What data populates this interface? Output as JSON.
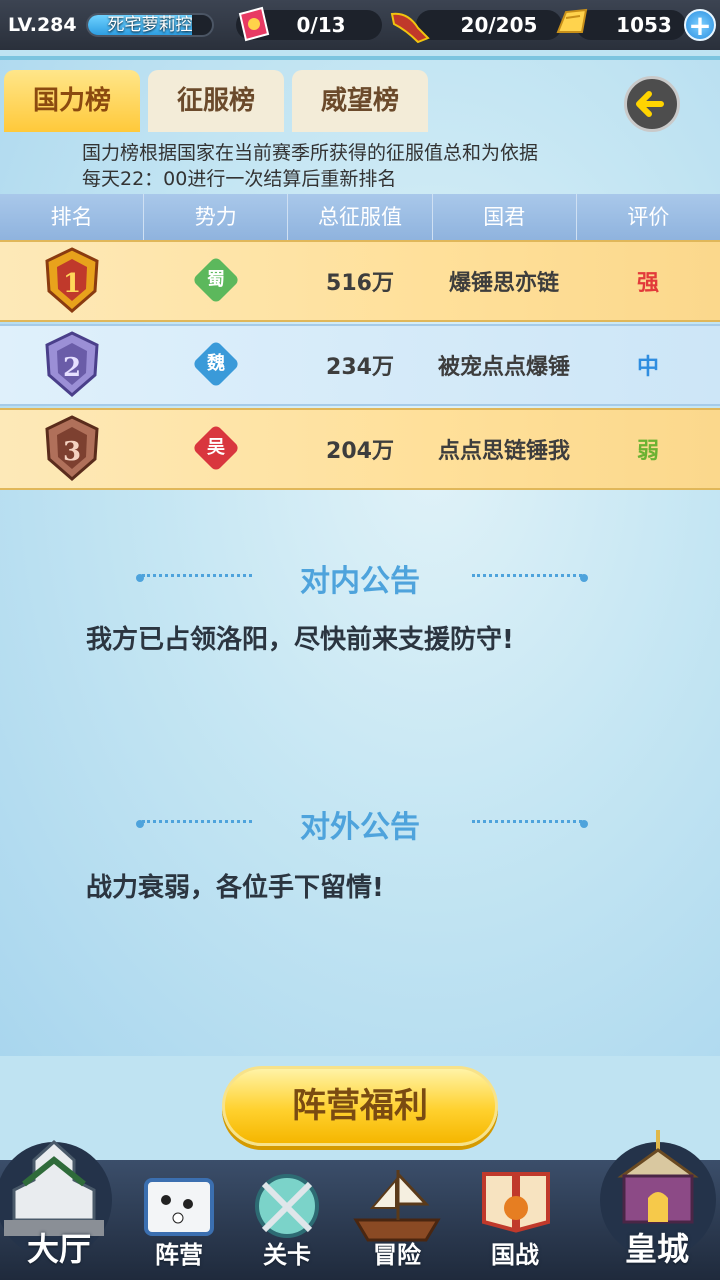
{
  "status": {
    "level": "LV.284",
    "player_name": "死宅萝莉控",
    "exp_fraction": 0.84,
    "tickets": "0/13",
    "stamina": "20/205",
    "gold": "1053"
  },
  "tabs": [
    {
      "label": "国力榜",
      "active": true
    },
    {
      "label": "征服榜",
      "active": false
    },
    {
      "label": "威望榜",
      "active": false
    }
  ],
  "description": {
    "line1": "国力榜根据国家在当前赛季所获得的征服值总和为依据",
    "line2": "每天22：00进行一次结算后重新排名"
  },
  "table": {
    "headers": [
      "排名",
      "势力",
      "总征服值",
      "国君",
      "评价"
    ],
    "rows": [
      {
        "rank": "1",
        "faction": "蜀",
        "faction_color": "#5cb85c",
        "value": "516万",
        "ruler": "爆锤思亦链",
        "rating": "强",
        "rating_color": "#e23a3a"
      },
      {
        "rank": "2",
        "faction": "魏",
        "faction_color": "#3a9ad9",
        "value": "234万",
        "ruler": "被宠点点爆锤",
        "rating": "中",
        "rating_color": "#2f8de0"
      },
      {
        "rank": "3",
        "faction": "吴",
        "faction_color": "#d9363e",
        "value": "204万",
        "ruler": "点点思链锤我",
        "rating": "弱",
        "rating_color": "#6bb232"
      }
    ]
  },
  "internal_notice": {
    "title": "对内公告",
    "text": "我方已占领洛阳，尽快前来支援防守!"
  },
  "external_notice": {
    "title": "对外公告",
    "text": "战力衰弱，各位手下留情!"
  },
  "welfare_button": "阵营福利",
  "nav": {
    "hall": "大厅",
    "camp": "阵营",
    "stage": "关卡",
    "adventure": "冒险",
    "war": "国战",
    "palace": "皇城"
  },
  "colors": {
    "accent_blue": "#4ea3dc",
    "tab_active": "#ffc93a",
    "gold_row": "#ffe09a"
  }
}
